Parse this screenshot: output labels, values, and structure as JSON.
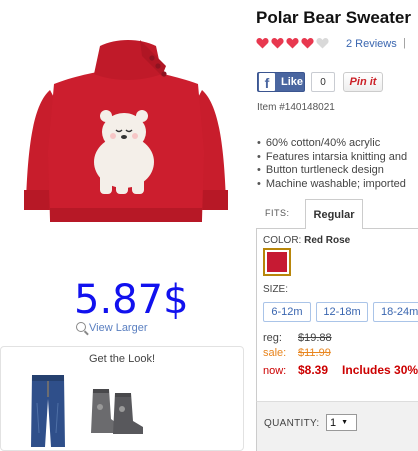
{
  "product": {
    "title": "Polar Bear Sweater",
    "reviews_label": "2 Reviews",
    "reviews_separator": "|",
    "rating": 4,
    "rating_max": 5,
    "item_number": "Item #140148021",
    "features": [
      "60% cotton/40% acrylic",
      "Features intarsia knitting and",
      "Button turtleneck design",
      "Machine washable; imported"
    ],
    "price_overlay": "5.87$",
    "view_larger": "View Larger",
    "colors": {
      "sweater": "#cc1e2e",
      "bear": "#f4efe9",
      "accent": "#3a66b0",
      "sale": "#e8851e",
      "now": "#cc0000"
    }
  },
  "social": {
    "like_label": "Like",
    "like_count": "0",
    "pin_label": "Pin it"
  },
  "fits": {
    "label": "FITS:",
    "selected": "Regular"
  },
  "color": {
    "label": "COLOR:",
    "value": "Red Rose",
    "swatch_hex": "#c61a33"
  },
  "sizes": {
    "label": "SIZE:",
    "options": [
      "6-12m",
      "12-18m",
      "18-24m"
    ]
  },
  "pricing": {
    "reg_label": "reg:",
    "reg_value": "$19.88",
    "sale_label": "sale:",
    "sale_value": "$11.99",
    "now_label": "now:",
    "now_value": "$8.39",
    "includes_text": "Includes 30%"
  },
  "quantity": {
    "label": "QUANTITY:",
    "value": "1"
  },
  "look": {
    "title": "Get the Look!"
  }
}
